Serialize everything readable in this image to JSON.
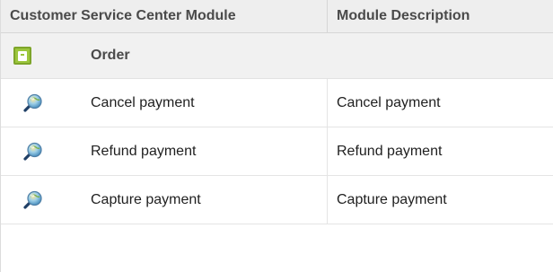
{
  "table": {
    "headers": {
      "module": "Customer Service Center Module",
      "description": "Module Description"
    },
    "group": {
      "label": "Order",
      "icon": "archive-box-icon",
      "icon_color": "#9cc63d"
    },
    "rows": [
      {
        "name": "Cancel payment",
        "description": "Cancel payment",
        "icon": "magnifier-globe-icon"
      },
      {
        "name": "Refund payment",
        "description": "Refund payment",
        "icon": "magnifier-globe-icon"
      },
      {
        "name": "Capture payment",
        "description": "Capture payment",
        "icon": "magnifier-globe-icon"
      }
    ]
  }
}
